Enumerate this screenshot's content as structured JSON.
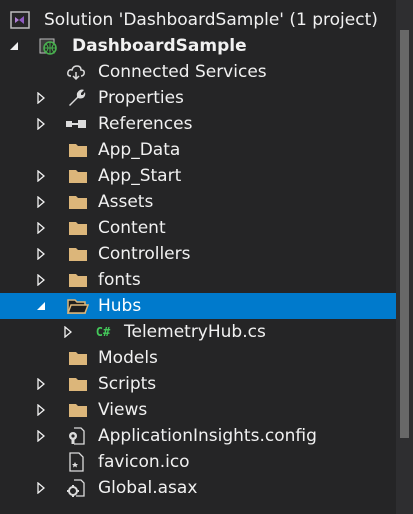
{
  "solution": {
    "label": "Solution 'DashboardSample' (1 project)",
    "icon": "visual-studio-solution-icon"
  },
  "project": {
    "label": "DashboardSample",
    "icon": "web-project-globe-icon",
    "expanded": true
  },
  "items": [
    {
      "label": "Connected Services",
      "icon": "cloud-icon",
      "has_arrow": false
    },
    {
      "label": "Properties",
      "icon": "wrench-icon",
      "has_arrow": true
    },
    {
      "label": "References",
      "icon": "references-icon",
      "has_arrow": true
    },
    {
      "label": "App_Data",
      "icon": "folder-icon",
      "has_arrow": false
    },
    {
      "label": "App_Start",
      "icon": "folder-icon",
      "has_arrow": true
    },
    {
      "label": "Assets",
      "icon": "folder-icon",
      "has_arrow": true
    },
    {
      "label": "Content",
      "icon": "folder-icon",
      "has_arrow": true
    },
    {
      "label": "Controllers",
      "icon": "folder-icon",
      "has_arrow": true
    },
    {
      "label": "fonts",
      "icon": "folder-icon",
      "has_arrow": true
    },
    {
      "label": "Hubs",
      "icon": "open-folder-icon",
      "has_arrow": true,
      "expanded": true,
      "selected": true
    },
    {
      "label": "TelemetryHub.cs",
      "icon": "csharp-file-icon",
      "icon_text": "C#",
      "has_arrow": true
    },
    {
      "label": "Models",
      "icon": "folder-icon",
      "has_arrow": false
    },
    {
      "label": "Scripts",
      "icon": "folder-icon",
      "has_arrow": true
    },
    {
      "label": "Views",
      "icon": "folder-icon",
      "has_arrow": true
    },
    {
      "label": "ApplicationInsights.config",
      "icon": "config-file-icon",
      "has_arrow": true
    },
    {
      "label": "favicon.ico",
      "icon": "ico-file-icon",
      "has_arrow": false
    },
    {
      "label": "Global.asax",
      "icon": "global-asax-icon",
      "has_arrow": true
    }
  ],
  "colors": {
    "background": "#252526",
    "selection": "#007acc",
    "folder": "#dcb67a",
    "text": "#f1f1f1"
  }
}
